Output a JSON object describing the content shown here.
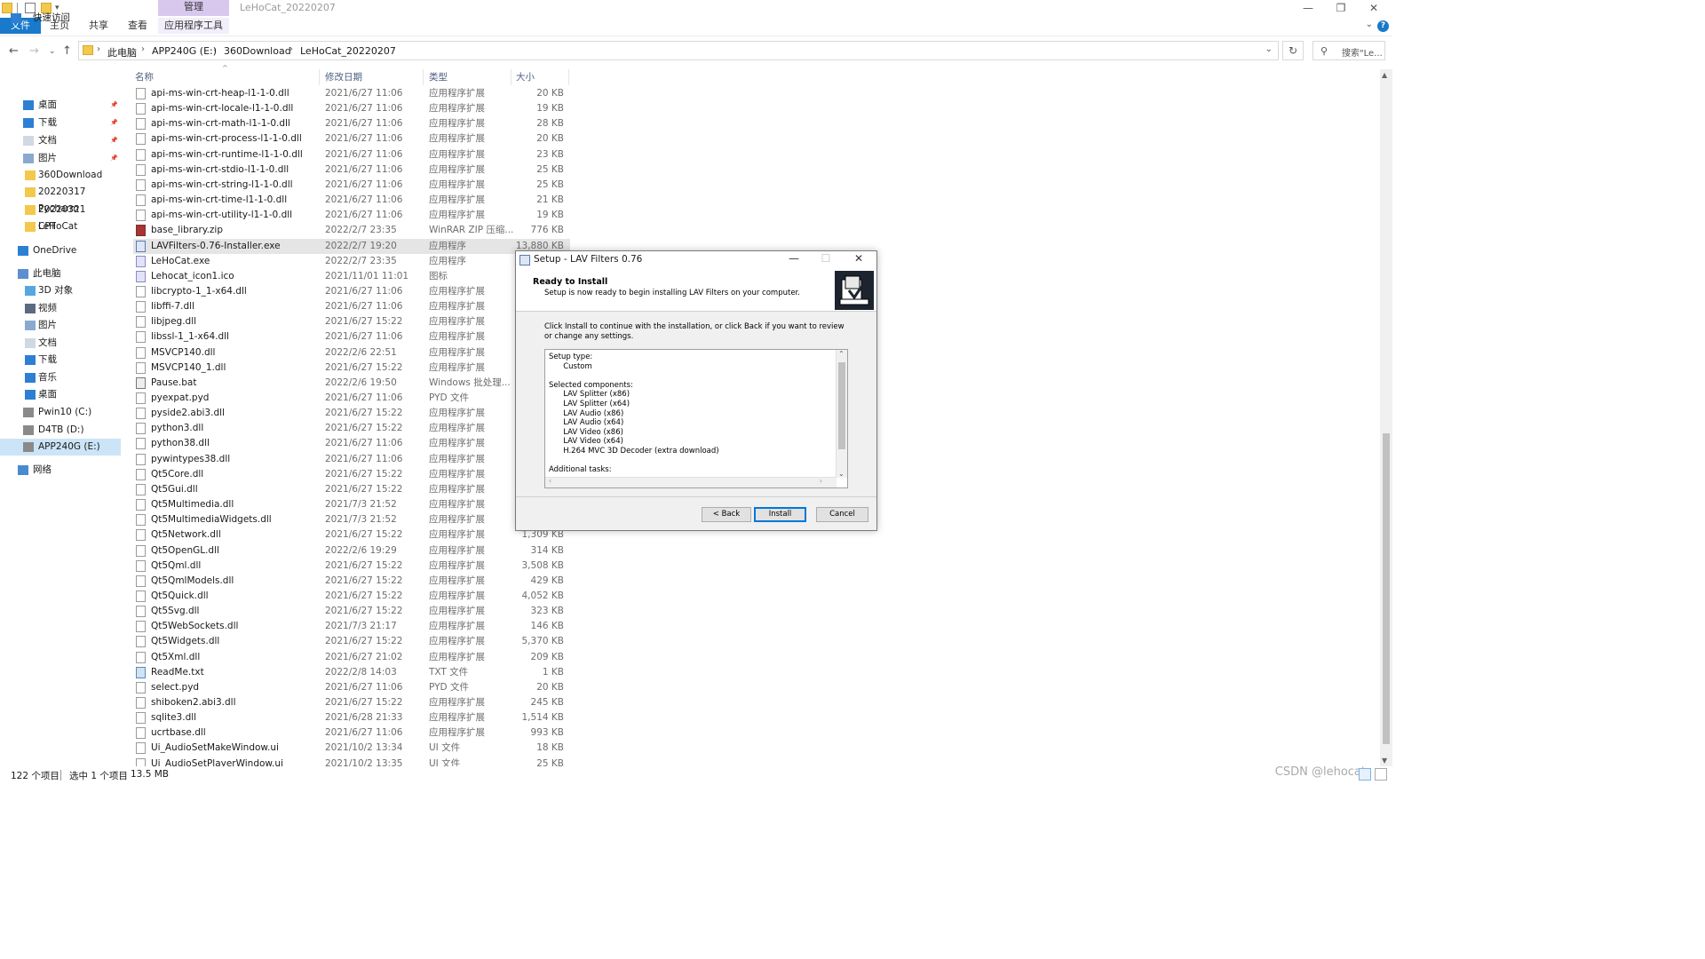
{
  "window": {
    "title": "LeHoCat_20220207",
    "manage_tab": "管理",
    "controls": {
      "minimize": "—",
      "restore": "❐",
      "close": "✕"
    }
  },
  "ribbon": {
    "tabs": [
      "文件",
      "主页",
      "共享",
      "查看",
      "应用程序工具"
    ],
    "accent": "#1979ca"
  },
  "address": {
    "crumbs": [
      "此电脑",
      "APP240G (E:)",
      "360Download",
      "LeHoCat_20220207"
    ],
    "search_placeholder": "搜索\"Le..."
  },
  "sidebar": {
    "items": [
      {
        "label": "快速访问",
        "icon": "star-icon"
      },
      {
        "label": "桌面",
        "icon": "desktop-icon",
        "pinned": true
      },
      {
        "label": "下载",
        "icon": "download-icon",
        "pinned": true
      },
      {
        "label": "文档",
        "icon": "document-icon",
        "pinned": true
      },
      {
        "label": "图片",
        "icon": "picture-icon",
        "pinned": true
      },
      {
        "label": "360Download",
        "icon": "folder-icon"
      },
      {
        "label": "20220317 Pycharm",
        "icon": "folder-icon"
      },
      {
        "label": "20220321 LeHoCat",
        "icon": "folder-icon"
      },
      {
        "label": "CPT",
        "icon": "folder-icon"
      },
      {
        "label": "OneDrive",
        "icon": "cloud-icon"
      },
      {
        "label": "此电脑",
        "icon": "computer-icon"
      },
      {
        "label": "3D 对象",
        "icon": "cube-icon"
      },
      {
        "label": "视频",
        "icon": "video-icon"
      },
      {
        "label": "图片",
        "icon": "picture-icon"
      },
      {
        "label": "文档",
        "icon": "document-icon"
      },
      {
        "label": "下载",
        "icon": "download-icon"
      },
      {
        "label": "音乐",
        "icon": "music-icon"
      },
      {
        "label": "桌面",
        "icon": "desktop-icon"
      },
      {
        "label": "Pwin10 (C:)",
        "icon": "drive-icon"
      },
      {
        "label": "D4TB (D:)",
        "icon": "drive-icon"
      },
      {
        "label": "APP240G (E:)",
        "icon": "drive-icon",
        "selected": true
      },
      {
        "label": "网络",
        "icon": "network-icon"
      }
    ]
  },
  "filelist": {
    "columns": {
      "name": "名称",
      "date": "修改日期",
      "type": "类型",
      "size": "大小"
    },
    "rows": [
      {
        "name": "api-ms-win-crt-heap-l1-1-0.dll",
        "date": "2021/6/27 11:06",
        "type": "应用程序扩展",
        "size": "20 KB",
        "icon": "dll"
      },
      {
        "name": "api-ms-win-crt-locale-l1-1-0.dll",
        "date": "2021/6/27 11:06",
        "type": "应用程序扩展",
        "size": "19 KB",
        "icon": "dll"
      },
      {
        "name": "api-ms-win-crt-math-l1-1-0.dll",
        "date": "2021/6/27 11:06",
        "type": "应用程序扩展",
        "size": "28 KB",
        "icon": "dll"
      },
      {
        "name": "api-ms-win-crt-process-l1-1-0.dll",
        "date": "2021/6/27 11:06",
        "type": "应用程序扩展",
        "size": "20 KB",
        "icon": "dll"
      },
      {
        "name": "api-ms-win-crt-runtime-l1-1-0.dll",
        "date": "2021/6/27 11:06",
        "type": "应用程序扩展",
        "size": "23 KB",
        "icon": "dll"
      },
      {
        "name": "api-ms-win-crt-stdio-l1-1-0.dll",
        "date": "2021/6/27 11:06",
        "type": "应用程序扩展",
        "size": "25 KB",
        "icon": "dll"
      },
      {
        "name": "api-ms-win-crt-string-l1-1-0.dll",
        "date": "2021/6/27 11:06",
        "type": "应用程序扩展",
        "size": "25 KB",
        "icon": "dll"
      },
      {
        "name": "api-ms-win-crt-time-l1-1-0.dll",
        "date": "2021/6/27 11:06",
        "type": "应用程序扩展",
        "size": "21 KB",
        "icon": "dll"
      },
      {
        "name": "api-ms-win-crt-utility-l1-1-0.dll",
        "date": "2021/6/27 11:06",
        "type": "应用程序扩展",
        "size": "19 KB",
        "icon": "dll"
      },
      {
        "name": "base_library.zip",
        "date": "2022/2/7 23:35",
        "type": "WinRAR ZIP 压缩...",
        "size": "776 KB",
        "icon": "zip"
      },
      {
        "name": "LAVFilters-0.76-Installer.exe",
        "date": "2022/2/7 19:20",
        "type": "应用程序",
        "size": "13,880 KB",
        "icon": "exe",
        "selected": true
      },
      {
        "name": "LeHoCat.exe",
        "date": "2022/2/7 23:35",
        "type": "应用程序",
        "size": "",
        "icon": "ico"
      },
      {
        "name": "Lehocat_icon1.ico",
        "date": "2021/11/01 11:01",
        "type": "图标",
        "size": "",
        "icon": "ico"
      },
      {
        "name": "libcrypto-1_1-x64.dll",
        "date": "2021/6/27 11:06",
        "type": "应用程序扩展",
        "size": "",
        "icon": "dll"
      },
      {
        "name": "libffi-7.dll",
        "date": "2021/6/27 11:06",
        "type": "应用程序扩展",
        "size": "",
        "icon": "dll"
      },
      {
        "name": "libjpeg.dll",
        "date": "2021/6/27 15:22",
        "type": "应用程序扩展",
        "size": "",
        "icon": "dll"
      },
      {
        "name": "libssl-1_1-x64.dll",
        "date": "2021/6/27 11:06",
        "type": "应用程序扩展",
        "size": "",
        "icon": "dll"
      },
      {
        "name": "MSVCP140.dll",
        "date": "2022/2/6 22:51",
        "type": "应用程序扩展",
        "size": "",
        "icon": "dll"
      },
      {
        "name": "MSVCP140_1.dll",
        "date": "2021/6/27 15:22",
        "type": "应用程序扩展",
        "size": "",
        "icon": "dll"
      },
      {
        "name": "Pause.bat",
        "date": "2022/2/6 19:50",
        "type": "Windows 批处理...",
        "size": "",
        "icon": "bat"
      },
      {
        "name": "pyexpat.pyd",
        "date": "2021/6/27 11:06",
        "type": "PYD 文件",
        "size": "",
        "icon": "dll"
      },
      {
        "name": "pyside2.abi3.dll",
        "date": "2021/6/27 15:22",
        "type": "应用程序扩展",
        "size": "",
        "icon": "dll"
      },
      {
        "name": "python3.dll",
        "date": "2021/6/27 15:22",
        "type": "应用程序扩展",
        "size": "",
        "icon": "dll"
      },
      {
        "name": "python38.dll",
        "date": "2021/6/27 11:06",
        "type": "应用程序扩展",
        "size": "",
        "icon": "dll"
      },
      {
        "name": "pywintypes38.dll",
        "date": "2021/6/27 11:06",
        "type": "应用程序扩展",
        "size": "",
        "icon": "dll"
      },
      {
        "name": "Qt5Core.dll",
        "date": "2021/6/27 15:22",
        "type": "应用程序扩展",
        "size": "",
        "icon": "dll"
      },
      {
        "name": "Qt5Gui.dll",
        "date": "2021/6/27 15:22",
        "type": "应用程序扩展",
        "size": "",
        "icon": "dll"
      },
      {
        "name": "Qt5Multimedia.dll",
        "date": "2021/7/3 21:52",
        "type": "应用程序扩展",
        "size": "",
        "icon": "dll"
      },
      {
        "name": "Qt5MultimediaWidgets.dll",
        "date": "2021/7/3 21:52",
        "type": "应用程序扩展",
        "size": "",
        "icon": "dll"
      },
      {
        "name": "Qt5Network.dll",
        "date": "2021/6/27 15:22",
        "type": "应用程序扩展",
        "size": "1,309 KB",
        "icon": "dll"
      },
      {
        "name": "Qt5OpenGL.dll",
        "date": "2022/2/6 19:29",
        "type": "应用程序扩展",
        "size": "314 KB",
        "icon": "dll"
      },
      {
        "name": "Qt5Qml.dll",
        "date": "2021/6/27 15:22",
        "type": "应用程序扩展",
        "size": "3,508 KB",
        "icon": "dll"
      },
      {
        "name": "Qt5QmlModels.dll",
        "date": "2021/6/27 15:22",
        "type": "应用程序扩展",
        "size": "429 KB",
        "icon": "dll"
      },
      {
        "name": "Qt5Quick.dll",
        "date": "2021/6/27 15:22",
        "type": "应用程序扩展",
        "size": "4,052 KB",
        "icon": "dll"
      },
      {
        "name": "Qt5Svg.dll",
        "date": "2021/6/27 15:22",
        "type": "应用程序扩展",
        "size": "323 KB",
        "icon": "dll"
      },
      {
        "name": "Qt5WebSockets.dll",
        "date": "2021/7/3 21:17",
        "type": "应用程序扩展",
        "size": "146 KB",
        "icon": "dll"
      },
      {
        "name": "Qt5Widgets.dll",
        "date": "2021/6/27 15:22",
        "type": "应用程序扩展",
        "size": "5,370 KB",
        "icon": "dll"
      },
      {
        "name": "Qt5Xml.dll",
        "date": "2021/6/27 21:02",
        "type": "应用程序扩展",
        "size": "209 KB",
        "icon": "dll"
      },
      {
        "name": "ReadMe.txt",
        "date": "2022/2/8 14:03",
        "type": "TXT 文件",
        "size": "1 KB",
        "icon": "txt"
      },
      {
        "name": "select.pyd",
        "date": "2021/6/27 11:06",
        "type": "PYD 文件",
        "size": "20 KB",
        "icon": "file"
      },
      {
        "name": "shiboken2.abi3.dll",
        "date": "2021/6/27 15:22",
        "type": "应用程序扩展",
        "size": "245 KB",
        "icon": "dll"
      },
      {
        "name": "sqlite3.dll",
        "date": "2021/6/28 21:33",
        "type": "应用程序扩展",
        "size": "1,514 KB",
        "icon": "dll"
      },
      {
        "name": "ucrtbase.dll",
        "date": "2021/6/27 11:06",
        "type": "应用程序扩展",
        "size": "993 KB",
        "icon": "dll"
      },
      {
        "name": "Ui_AudioSetMakeWindow.ui",
        "date": "2021/10/2 13:34",
        "type": "UI 文件",
        "size": "18 KB",
        "icon": "file"
      },
      {
        "name": "Ui_AudioSetPlayerWindow.ui",
        "date": "2021/10/2 13:35",
        "type": "UI 文件",
        "size": "25 KB",
        "icon": "file"
      }
    ]
  },
  "statusbar": {
    "count": "122 个项目",
    "selected": "选中 1 个项目",
    "selected_size": "13.5 MB",
    "watermark": "CSDN @lehocat"
  },
  "dialog": {
    "title": "Setup - LAV Filters 0.76",
    "heading": "Ready to Install",
    "subheading": "Setup is now ready to begin installing LAV Filters on your computer.",
    "instruction": "Click Install to continue with the installation, or click Back if you want to review or change any settings.",
    "memo_lines": [
      "Setup type:",
      "      Custom",
      "",
      "Selected components:",
      "      LAV Splitter (x86)",
      "      LAV Splitter (x64)",
      "      LAV Audio (x86)",
      "      LAV Audio (x64)",
      "      LAV Video (x86)",
      "      LAV Video (x64)",
      "      H.264 MVC 3D Decoder (extra download)",
      "",
      "Additional tasks:"
    ],
    "buttons": {
      "back": "< Back",
      "install": "Install",
      "cancel": "Cancel"
    },
    "controls": {
      "minimize": "—",
      "maximize": "☐",
      "close": "✕"
    }
  }
}
